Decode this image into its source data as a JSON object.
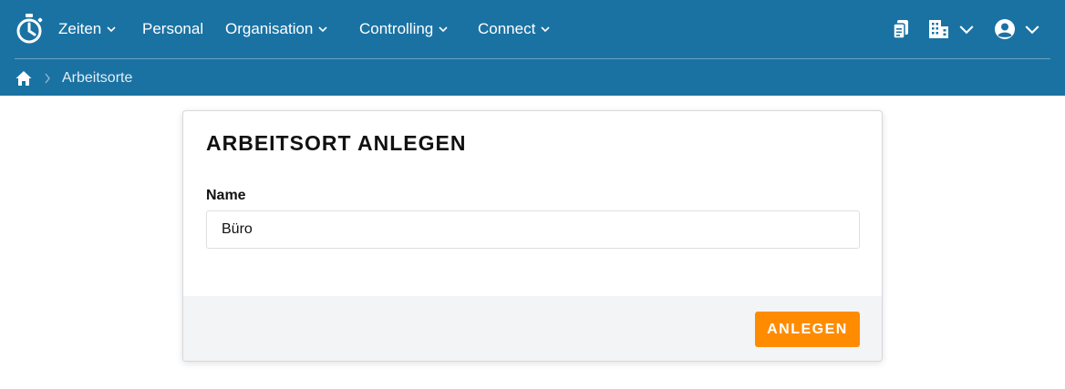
{
  "nav": {
    "items": [
      {
        "label": "Zeiten",
        "has_menu": true
      },
      {
        "label": "Personal",
        "has_menu": false
      },
      {
        "label": "Organisation",
        "has_menu": true
      },
      {
        "label": "Controlling",
        "has_menu": true
      },
      {
        "label": "Connect",
        "has_menu": true
      }
    ],
    "right_icons": [
      "clipboard-icon",
      "building-icon",
      "user-avatar-icon"
    ]
  },
  "breadcrumb": {
    "home_icon": "home-icon",
    "current": "Arbeitsorte"
  },
  "form": {
    "title": "ARBEITSORT ANLEGEN",
    "name_label": "Name",
    "name_value": "Büro",
    "submit_label": "ANLEGEN"
  },
  "colors": {
    "header": "#1a72a3",
    "accent": "#ff8c00",
    "footer_bg": "#f3f4f6"
  }
}
